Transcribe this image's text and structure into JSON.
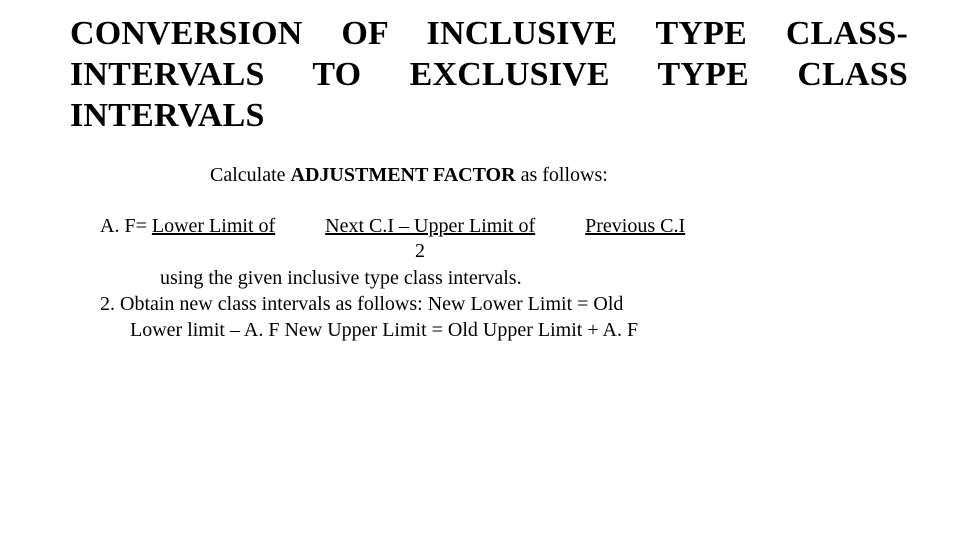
{
  "title": "CONVERSION OF INCLUSIVE TYPE CLASS-INTERVALS TO EXCLUSIVE TYPE CLASS INTERVALS",
  "subtitle_pre": "Calculate ",
  "subtitle_bold": "ADJUSTMENT FACTOR",
  "subtitle_post": " as follows:",
  "formula_lead": "A. F= ",
  "formula_part1": "Lower Limit of",
  "formula_gap1": "          ",
  "formula_part2": "Next C.I – Upper Limit of",
  "formula_gap2": "          ",
  "formula_part3": "Previous C.I",
  "formula_denom": "2",
  "line_using": "using the given inclusive type class intervals.",
  "line_step2a": "2. Obtain new class intervals                    as follows:  New Lower Limit = Old",
  "line_step2b": "Lower limit – A. F  New Upper Limit = Old Upper Limit + A. F"
}
